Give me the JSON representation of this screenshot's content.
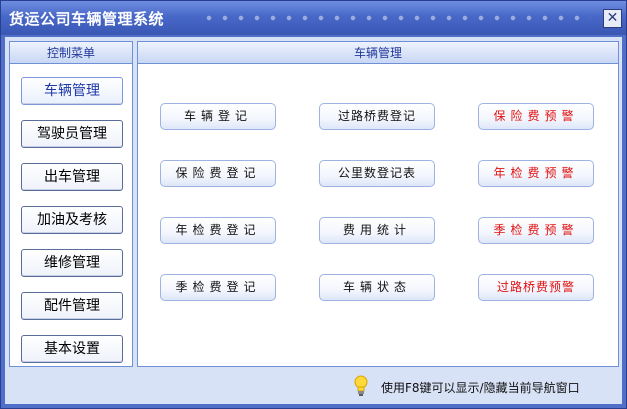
{
  "window": {
    "title": "货运公司车辆管理系统",
    "close_glyph": "✕"
  },
  "left_menu": {
    "header": "控制菜单",
    "items": [
      {
        "label": "车辆管理",
        "active": true
      },
      {
        "label": "驾驶员管理",
        "active": false
      },
      {
        "label": "出车管理",
        "active": false
      },
      {
        "label": "加油及考核",
        "active": false
      },
      {
        "label": "维修管理",
        "active": false
      },
      {
        "label": "配件管理",
        "active": false
      },
      {
        "label": "基本设置",
        "active": false
      }
    ]
  },
  "main": {
    "header": "车辆管理",
    "buttons": [
      [
        "车辆登记",
        "过路桥费登记",
        "保险费预警"
      ],
      [
        "保险费登记",
        "公里数登记表",
        "年检费预警"
      ],
      [
        "年检费登记",
        "费用统计",
        "季检费预警"
      ],
      [
        "季检费登记",
        "车辆状态",
        "过路桥费预警"
      ]
    ],
    "warning_color": "#e01010"
  },
  "status": {
    "hint": "使用F8键可以显示/隐藏当前导航窗口",
    "icon": "lightbulb-icon"
  }
}
